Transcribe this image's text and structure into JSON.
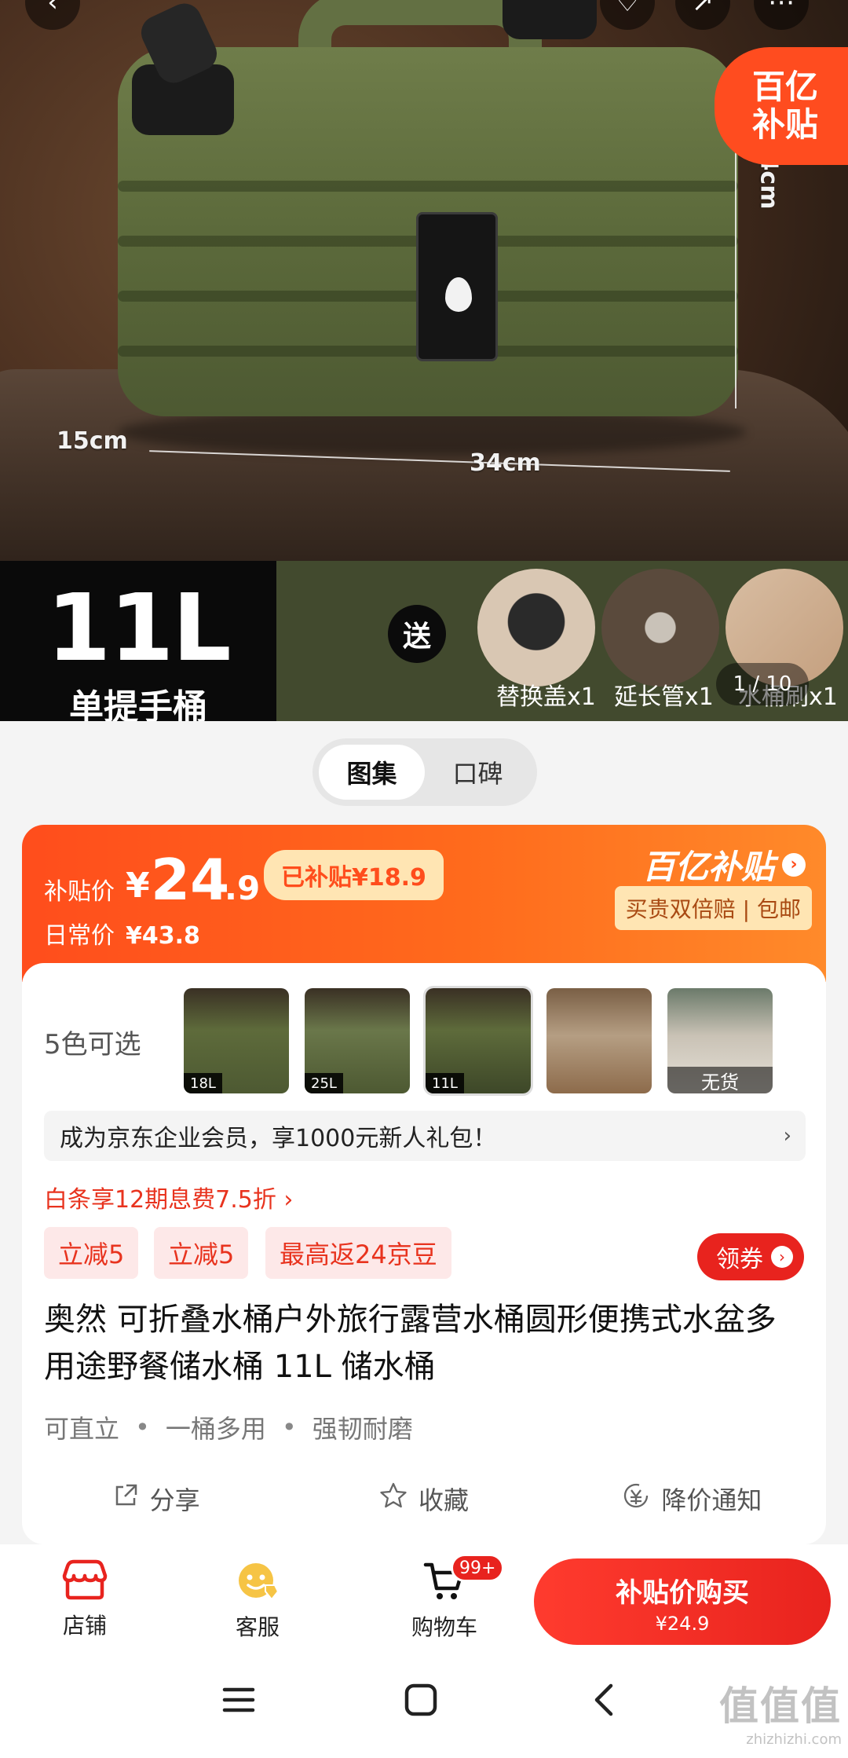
{
  "hero": {
    "dims": {
      "height": "4cm",
      "depth": "15cm",
      "width": "34cm"
    },
    "badge": {
      "line1": "百亿",
      "line2": "补贴"
    },
    "size": {
      "volume": "11L",
      "type": "单提手桶"
    },
    "gift_label": "送",
    "accessories": [
      {
        "label": "替换盖x1"
      },
      {
        "label": "延长管x1"
      },
      {
        "label": "水桶刷x1"
      }
    ],
    "counter": {
      "current": "1",
      "total": "10"
    }
  },
  "tabs": [
    {
      "label": "图集",
      "active": true
    },
    {
      "label": "口碑",
      "active": false
    }
  ],
  "price": {
    "subsidy_label": "补贴价",
    "currency": "¥",
    "integer": "24",
    "decimal": ".9",
    "subsidized": "已补贴¥18.9",
    "daily_label": "日常价",
    "daily_value": "¥43.8",
    "brand": "百亿补贴",
    "guarantee": "买贵双倍赔 | 包邮"
  },
  "variants": {
    "label": "5色可选",
    "items": [
      {
        "tag": "18L"
      },
      {
        "tag": "25L"
      },
      {
        "tag": "11L"
      },
      {
        "tag": ""
      },
      {
        "tag": "",
        "status": "无货"
      }
    ]
  },
  "member_bar": {
    "text": "成为京东企业会员，享1000元新人礼包！",
    "chevron": "›"
  },
  "baitiao": "白条享12期息费7.5折 ›",
  "coupons": [
    "立减5",
    "立减5",
    "最高返24京豆"
  ],
  "claim_label": "领券",
  "title": "奥然 可折叠水桶户外旅行露营水桶圆形便携式水盆多用途野餐储水桶 11L 储水桶",
  "features": [
    "可直立",
    "一桶多用",
    "强韧耐磨"
  ],
  "actions": [
    {
      "label": "分享",
      "icon": "share-icon"
    },
    {
      "label": "收藏",
      "icon": "star-icon"
    },
    {
      "label": "降价通知",
      "icon": "price-drop-icon"
    }
  ],
  "bottom_bar": {
    "store": "店铺",
    "service": "客服",
    "cart": "购物车",
    "cart_badge": "99+",
    "buy_line1": "补贴价购买",
    "buy_line2": "¥24.9"
  },
  "watermark": {
    "text": "值值值",
    "domain": "zhizhizhi.com"
  },
  "colors": {
    "accent_red": "#e8231e",
    "subsidy_orange": "#ff4d1c",
    "guarantee_bg": "#ffe5b3"
  }
}
